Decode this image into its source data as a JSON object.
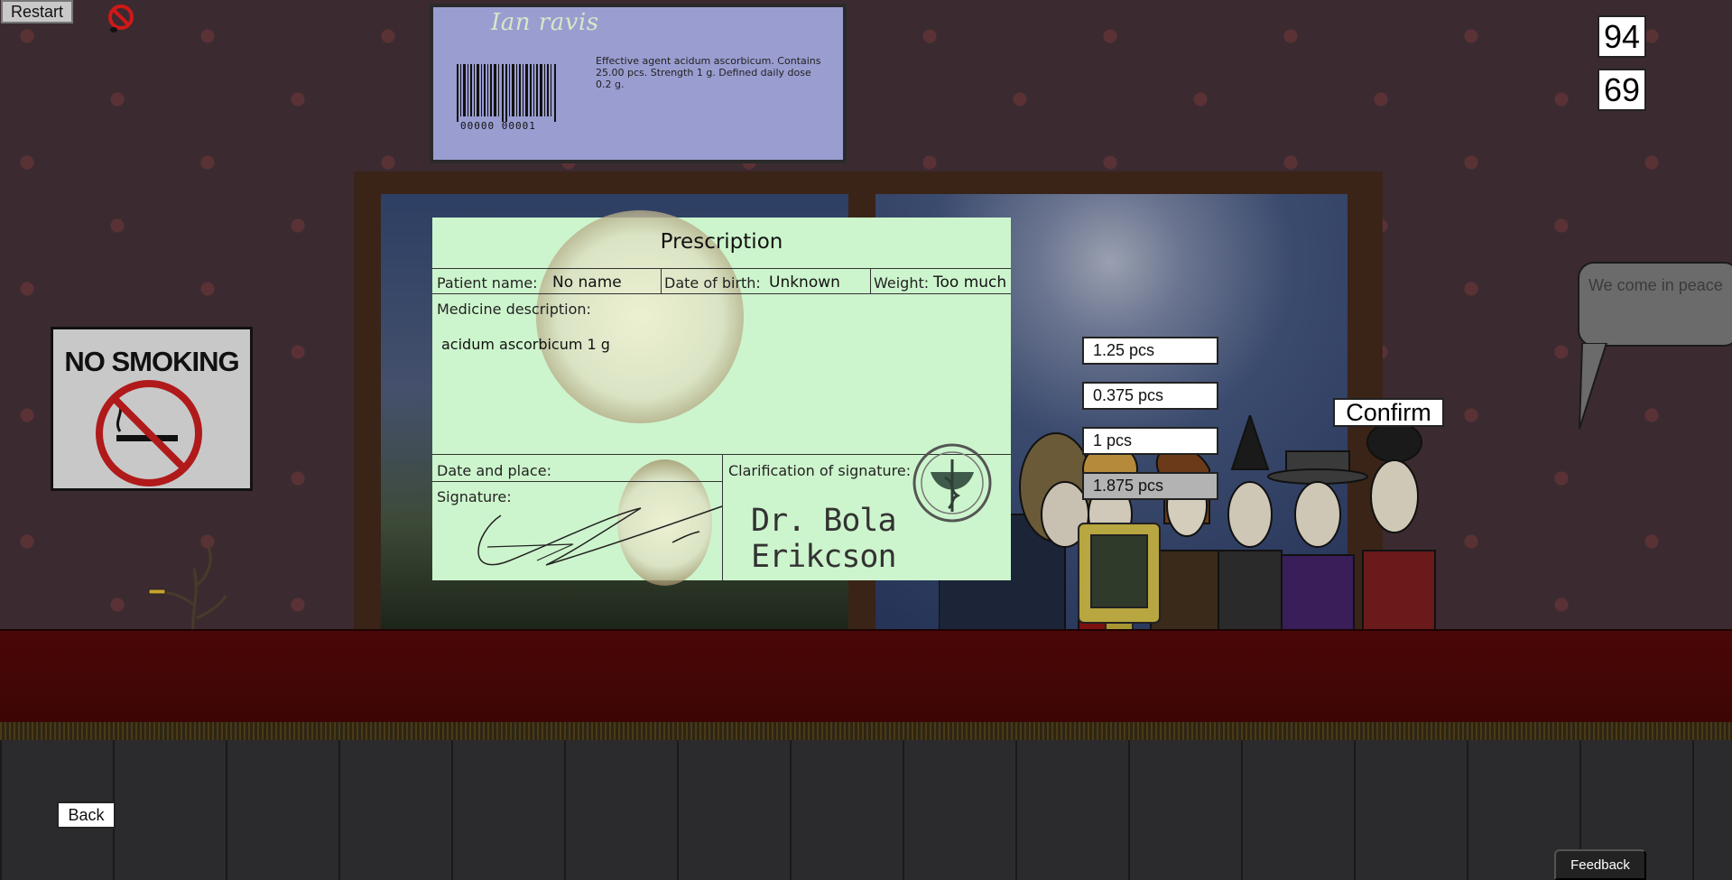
{
  "toolbar": {
    "restart_label": "Restart"
  },
  "counters": {
    "top": "94",
    "bottom": "69"
  },
  "medicine": {
    "name": "Ian ravis",
    "description": "Effective agent acidum ascorbicum. Contains 25.00 pcs. Strength 1 g. Defined daily dose 0.2 g.",
    "barcode": "00000 00001"
  },
  "sign": {
    "text": "NO SMOKING"
  },
  "prescription": {
    "title": "Prescription",
    "patient_name_label": "Patient name:",
    "patient_name": "No name",
    "dob_label": "Date of birth:",
    "dob": "Unknown",
    "weight_label": "Weight:",
    "weight": "Too much",
    "medicine_label": "Medicine description:",
    "medicine": "acidum ascorbicum 1 g",
    "date_place_label": "Date and place:",
    "signature_label": "Signature:",
    "clarification_label": "Clarification of signature:",
    "doctor": "Dr. Bola Erikcson"
  },
  "options": [
    {
      "label": "1.25 pcs",
      "selected": false
    },
    {
      "label": "0.375 pcs",
      "selected": false
    },
    {
      "label": "1 pcs",
      "selected": false
    },
    {
      "label": "1.875 pcs",
      "selected": true
    }
  ],
  "confirm_label": "Confirm",
  "speech": "We come in peace",
  "back_label": "Back",
  "feedback_label": "Feedback",
  "colors": {
    "prescription_bg": "#cdf5cd",
    "medbox_bg": "#9a9dd0",
    "desk": "#4a0707",
    "selected_option": "#b3b3b3"
  }
}
